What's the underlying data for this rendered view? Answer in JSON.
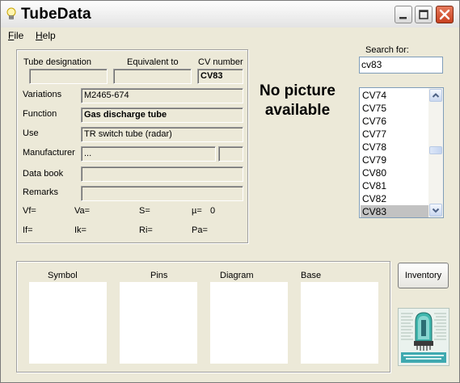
{
  "window": {
    "title": "TubeData"
  },
  "menu": {
    "file": "File",
    "file_rest": "ile",
    "file_key": "F",
    "help": "Help",
    "help_key": "H",
    "help_rest": "elp"
  },
  "labels": {
    "tube_designation": "Tube designation",
    "equivalent_to": "Equivalent to",
    "cv_number": "CV number",
    "variations": "Variations",
    "function": "Function",
    "use": "Use",
    "manufacturer": "Manufacturer",
    "data_book": "Data book",
    "remarks": "Remarks",
    "vf": "Vf=",
    "va": "Va=",
    "s": "S=",
    "mu": "µ=",
    "if": "If=",
    "ik": "Ik=",
    "ri": "Ri=",
    "pa": "Pa="
  },
  "fields": {
    "tube_designation": "",
    "equivalent_to": "",
    "cv_number": "CV83",
    "variations": "M2465-674",
    "function": "Gas discharge tube",
    "use": "TR switch tube (radar)",
    "manufacturer": "...",
    "manufacturer_code": "",
    "data_book": "",
    "remarks": "",
    "mu_value": "0"
  },
  "picture": {
    "placeholder": "No picture available"
  },
  "search": {
    "label": "Search for:",
    "value": "cv83"
  },
  "list": {
    "items": [
      "CV74",
      "CV75",
      "CV76",
      "CV77",
      "CV78",
      "CV79",
      "CV80",
      "CV81",
      "CV82",
      "CV83"
    ],
    "selected": "CV83"
  },
  "image_panel": {
    "symbol": "Symbol",
    "pins": "Pins",
    "diagram": "Diagram",
    "base": "Base"
  },
  "buttons": {
    "inventory": "Inventory"
  }
}
